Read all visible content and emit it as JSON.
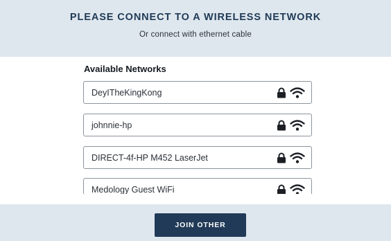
{
  "header": {
    "title": "PLEASE CONNECT TO A WIRELESS NETWORK",
    "subtitle": "Or connect with ethernet cable"
  },
  "networks_section": {
    "label": "Available Networks",
    "networks": [
      {
        "name": "DeyITheKingKong",
        "secured": true,
        "icons": [
          "lock-icon",
          "wifi-icon"
        ]
      },
      {
        "name": "johnnie-hp",
        "secured": true,
        "icons": [
          "lock-icon",
          "wifi-icon"
        ]
      },
      {
        "name": "DIRECT-4f-HP M452 LaserJet",
        "secured": true,
        "icons": [
          "lock-icon",
          "wifi-icon"
        ]
      },
      {
        "name": "Medology Guest WiFi",
        "secured": true,
        "icons": [
          "lock-icon",
          "wifi-icon"
        ]
      }
    ]
  },
  "footer": {
    "join_other_label": "JOIN OTHER"
  },
  "colors": {
    "header_bg": "#dfe7ee",
    "title_text": "#1f3a56",
    "button_bg": "#213a57",
    "item_border": "#8c949c"
  }
}
